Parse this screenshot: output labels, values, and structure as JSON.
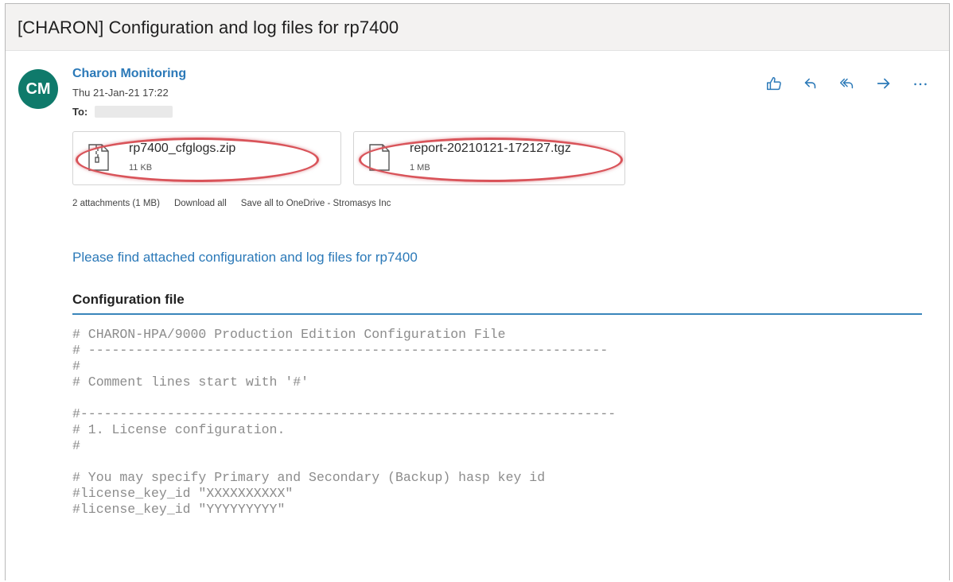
{
  "email": {
    "subject": "[CHARON] Configuration and log files for rp7400",
    "avatar_initials": "CM",
    "sender_name": "Charon Monitoring",
    "date": "Thu 21-Jan-21 17:22",
    "to_label": "To:",
    "accent_color": "#2b79b8",
    "avatar_color": "#0f7a6b"
  },
  "actions": [
    {
      "name": "like",
      "icon": "thumbs-up-icon"
    },
    {
      "name": "reply",
      "icon": "reply-icon"
    },
    {
      "name": "reply-all",
      "icon": "reply-all-icon"
    },
    {
      "name": "forward",
      "icon": "forward-icon"
    },
    {
      "name": "more",
      "icon": "more-icon"
    }
  ],
  "attachments": [
    {
      "filename": "rp7400_cfglogs.zip",
      "size": "11 KB",
      "icon": "zip-file-icon"
    },
    {
      "filename": "report-20210121-172127.tgz",
      "size": "1 MB",
      "icon": "file-icon"
    }
  ],
  "attachments_bar": {
    "summary": "2 attachments (1 MB)",
    "download_all": "Download all",
    "save_all": "Save all to OneDrive - Stromasys Inc"
  },
  "body": {
    "intro": "Please find attached configuration and log files for rp7400",
    "config_heading": "Configuration file",
    "code_lines": [
      "# CHARON-HPA/9000 Production Edition Configuration File",
      "# ------------------------------------------------------------------",
      "#",
      "# Comment lines start with '#'",
      "",
      "#--------------------------------------------------------------------",
      "# 1. License configuration.",
      "#",
      "",
      "# You may specify Primary and Secondary (Backup) hasp key id",
      "#license_key_id \"XXXXXXXXXX\"",
      "#license_key_id \"YYYYYYYYY\""
    ]
  }
}
